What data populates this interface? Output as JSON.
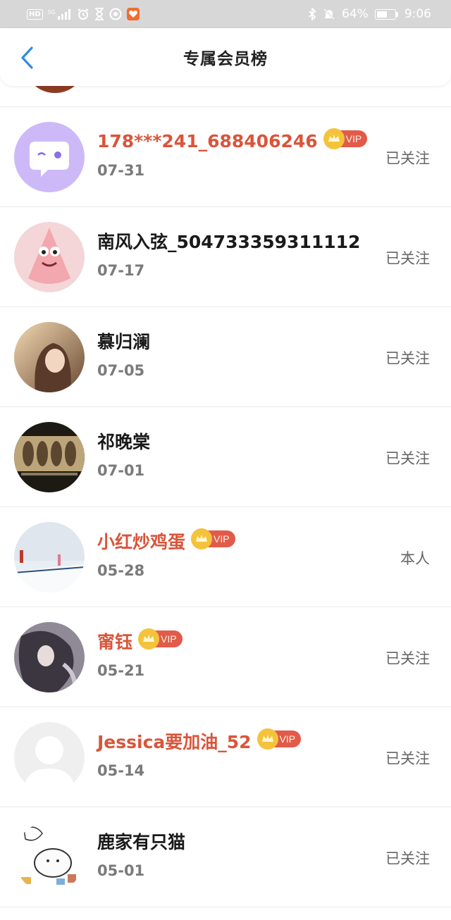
{
  "status_bar": {
    "hd": "HD",
    "signal": "5G",
    "battery_text": "64%",
    "battery_level": 0.64,
    "time": "9:06"
  },
  "header": {
    "title": "专属会员榜",
    "back_icon": "chevron-left-icon"
  },
  "colors": {
    "vip_name": "#d9553b",
    "normal_name": "#1a1a1a",
    "date": "#7a7a7a",
    "vip_badge": "#e25a4a",
    "crown": "#f5c33b",
    "back": "#2f8ce6"
  },
  "members": [
    {
      "name": "178***241_688406246",
      "date": "07-31",
      "vip": true,
      "vip_label": "VIP",
      "action": "已关注",
      "avatar": "default-chat-avatar"
    },
    {
      "name": "南风入弦_504733359311112",
      "date": "07-17",
      "vip": false,
      "action": "已关注",
      "avatar": "patrick-star-avatar"
    },
    {
      "name": "慕归澜",
      "date": "07-05",
      "vip": false,
      "action": "已关注",
      "avatar": "anime-girl-avatar"
    },
    {
      "name": "祁晚棠",
      "date": "07-01",
      "vip": false,
      "action": "已关注",
      "avatar": "group-photo-avatar"
    },
    {
      "name": "小红炒鸡蛋",
      "date": "05-28",
      "vip": true,
      "vip_label": "VIP",
      "action": "本人",
      "avatar": "snow-photo-avatar"
    },
    {
      "name": "甯钰",
      "date": "05-21",
      "vip": true,
      "vip_label": "VIP",
      "action": "已关注",
      "avatar": "anime-figure-avatar"
    },
    {
      "name": "Jessica要加油_52",
      "date": "05-14",
      "vip": true,
      "vip_label": "VIP",
      "action": "已关注",
      "avatar": "default-person-avatar"
    },
    {
      "name": "鹿家有只猫",
      "date": "05-01",
      "vip": false,
      "action": "已关注",
      "avatar": "cartoon-cat-avatar"
    }
  ]
}
